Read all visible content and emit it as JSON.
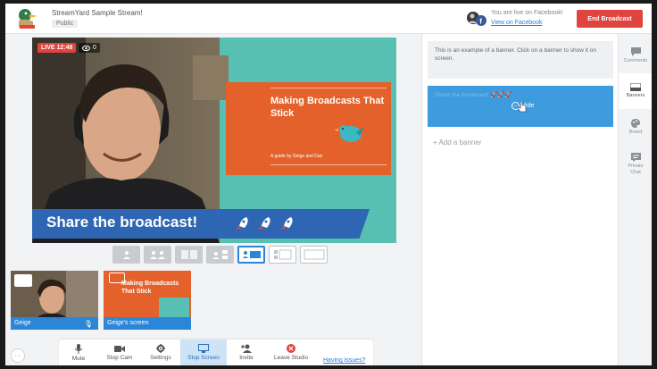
{
  "header": {
    "title": "StreamYard Sample Stream!",
    "privacy": "Public",
    "live_status": "You are live on Facebook!",
    "view_link": "View on Facebook",
    "end_button": "End Broadcast"
  },
  "stage": {
    "live_badge": "LIVE 12:48",
    "viewer_count": "0",
    "overlay_title": "Making Broadcasts That Stick",
    "overlay_subtitle": "A guide by Geige and Dan",
    "banner_text": "Share the broadcast!"
  },
  "thumbnails": [
    {
      "label": "Geige"
    },
    {
      "label": "Geige's screen",
      "overlay_title": "Making Broadcasts That Stick"
    }
  ],
  "controls": [
    {
      "label": "Mute",
      "icon": "mic-icon"
    },
    {
      "label": "Stop Cam",
      "icon": "camera-icon"
    },
    {
      "label": "Settings",
      "icon": "gear-icon"
    },
    {
      "label": "Stop Screen",
      "icon": "screen-icon"
    },
    {
      "label": "Invite",
      "icon": "add-user-icon"
    },
    {
      "label": "Leave Studio",
      "icon": "leave-icon"
    }
  ],
  "having_issues": "Having issues?",
  "more_button": "···",
  "panel": {
    "banner_example": "This is an example of a banner. Click on a banner to show it on screen.",
    "active_banner_text": "Share the broadcast! 🚀🚀🚀",
    "hide_label": "Hide",
    "add_banner": "+ Add a banner"
  },
  "sidetabs": [
    {
      "label": "Comments",
      "icon": "comment-icon"
    },
    {
      "label": "Banners",
      "icon": "banner-icon"
    },
    {
      "label": "Brand",
      "icon": "palette-icon"
    },
    {
      "label": "Private Chat",
      "icon": "chat-icon"
    }
  ],
  "colors": {
    "accent_blue": "#2c86d8",
    "live_red": "#e0443e",
    "overlay_orange": "#e4612b",
    "banner_blue": "#2f66b3"
  }
}
